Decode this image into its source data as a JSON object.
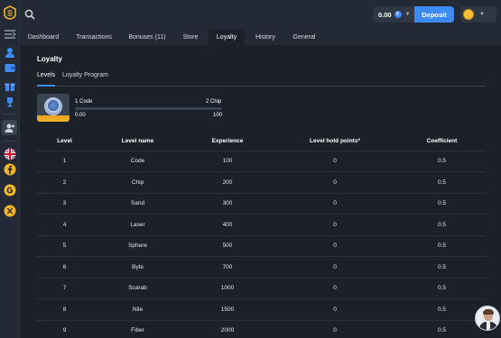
{
  "header": {
    "balance": "0.00",
    "currency_symbol": "€",
    "deposit_label": "Deposit"
  },
  "tabs": [
    {
      "label": "Dashboard"
    },
    {
      "label": "Transactions"
    },
    {
      "label": "Bonuses (11)"
    },
    {
      "label": "Store"
    },
    {
      "label": "Loyalty",
      "active": true
    },
    {
      "label": "History"
    },
    {
      "label": "General"
    }
  ],
  "page": {
    "title": "Loyalty",
    "subtabs": [
      {
        "label": "Levels",
        "active": true
      },
      {
        "label": "Loyalty Program"
      }
    ]
  },
  "progress": {
    "current_level": "1 Code",
    "next_level": "2 Chip",
    "current_value": "0.00",
    "target_value": "100",
    "fraction": 0
  },
  "table": {
    "headers": [
      "Level",
      "Level name",
      "Experience",
      "Level hold points*",
      "Coefficient"
    ],
    "rows": [
      [
        "1",
        "Code",
        "100",
        "0",
        "0.5"
      ],
      [
        "2",
        "Chip",
        "200",
        "0",
        "0.5"
      ],
      [
        "3",
        "Sand",
        "300",
        "0",
        "0.5"
      ],
      [
        "4",
        "Laser",
        "400",
        "0",
        "0.5"
      ],
      [
        "5",
        "Sphere",
        "500",
        "0",
        "0.5"
      ],
      [
        "6",
        "Byte",
        "700",
        "0",
        "0.5"
      ],
      [
        "7",
        "Scarab",
        "1000",
        "0",
        "0.5"
      ],
      [
        "8",
        "Nile",
        "1500",
        "0",
        "0.5"
      ],
      [
        "9",
        "Fiber",
        "2000",
        "0",
        "0.5"
      ]
    ]
  },
  "sidebar_icons": [
    "logo-icon",
    "collapse-menu-icon",
    "profile-icon",
    "wallet-icon",
    "gift-icon",
    "trophy-icon",
    "support-icon",
    "uk-flag-icon",
    "facebook-icon",
    "google-icon",
    "x-twitter-icon"
  ],
  "colors": {
    "accent": "#3d8bf2",
    "background": "#1b2029",
    "panel": "#232935",
    "badge_gold": "#f4b529"
  }
}
